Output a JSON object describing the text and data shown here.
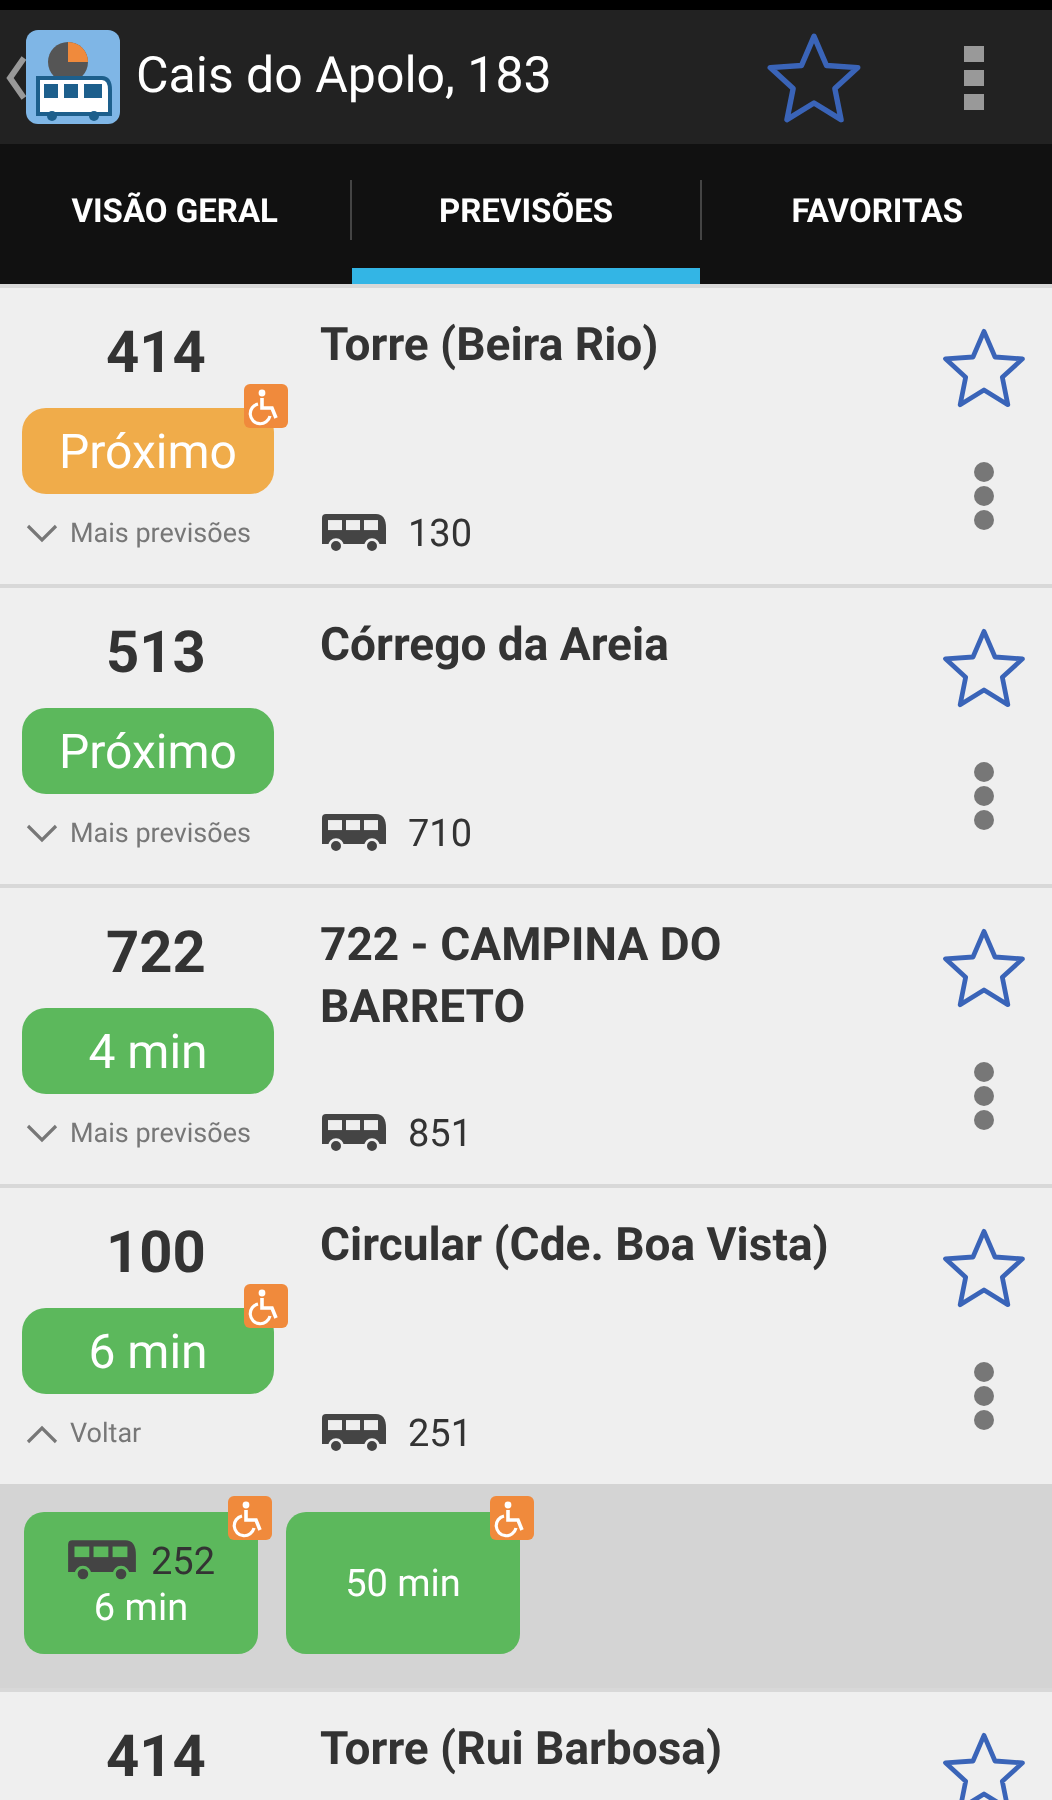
{
  "app_bar": {
    "title": "Cais do Apolo, 183",
    "favorite": false
  },
  "tabs": [
    {
      "label": "VISÃO GERAL",
      "selected": false
    },
    {
      "label": "PREVISÕES",
      "selected": true
    },
    {
      "label": "FAVORITAS",
      "selected": false
    }
  ],
  "rows": [
    {
      "route": "414",
      "name": "Torre (Beira Rio)",
      "favorite": false,
      "badge": {
        "text": "Próximo",
        "color": "#f0ac4a"
      },
      "accessible": true,
      "toggle": {
        "text": "Mais previsões",
        "expanded": false
      },
      "vehicle": "130"
    },
    {
      "route": "513",
      "name": "Córrego da Areia",
      "favorite": false,
      "badge": {
        "text": "Próximo",
        "color": "#5cb85c"
      },
      "accessible": false,
      "toggle": {
        "text": "Mais previsões",
        "expanded": false
      },
      "vehicle": "710"
    },
    {
      "route": "722",
      "name": "722 - CAMPINA DO BARRETO",
      "favorite": false,
      "badge": {
        "text": "4 min",
        "color": "#5cb85c"
      },
      "accessible": false,
      "toggle": {
        "text": "Mais previsões",
        "expanded": false
      },
      "vehicle": "851"
    },
    {
      "route": "100",
      "name": "Circular (Cde. Boa Vista)",
      "favorite": false,
      "badge": {
        "text": "6 min",
        "color": "#5cb85c"
      },
      "accessible": true,
      "toggle": {
        "text": "Voltar",
        "expanded": true
      },
      "vehicle": "251",
      "more": [
        {
          "vehicle": "252",
          "time": "6 min",
          "accessible": true,
          "color": "#5cb85c"
        },
        {
          "time": "50 min",
          "accessible": true,
          "color": "#5cb85c"
        }
      ]
    },
    {
      "route": "414",
      "name": "Torre (Rui Barbosa)",
      "favorite": false
    }
  ]
}
